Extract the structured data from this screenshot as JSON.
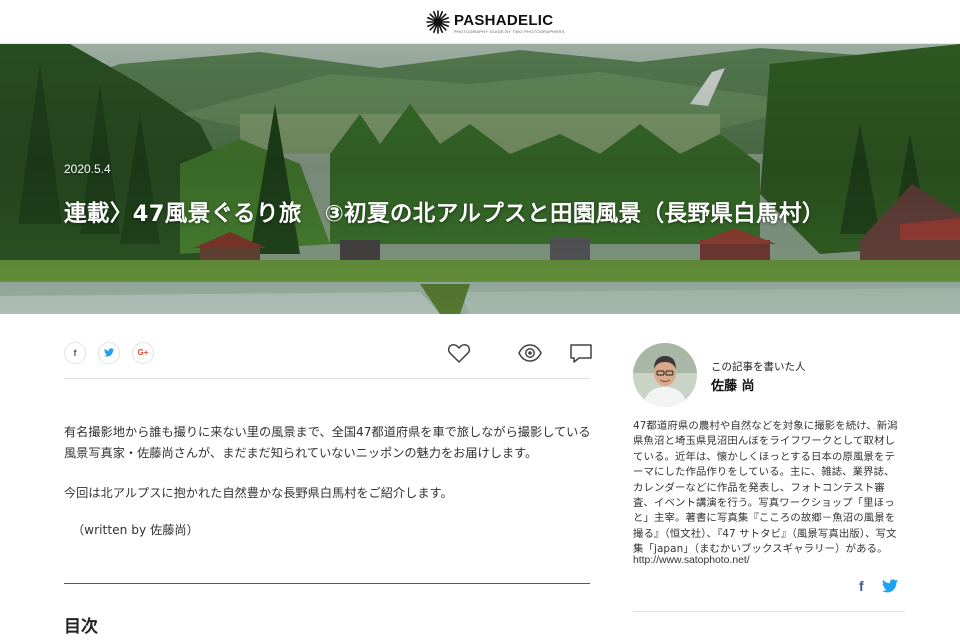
{
  "site": {
    "logo_text": "PASHADELIC",
    "logo_tagline": "PHOTOGRAPHY GUIDE BY TWO PHOTOGRAPHERS"
  },
  "article": {
    "date": "2020.5.4",
    "title": "連載〉47風景ぐるり旅　③初夏の北アルプスと田園風景（長野県白馬村）",
    "intro": "有名撮影地から誰も撮りに来ない里の風景まで、全国47都道府県を車で旅しながら撮影している風景写真家・佐藤尚さんが、まだまだ知られていないニッポンの魅力をお届けします。",
    "paragraph2": "今回は北アルプスに抱かれた自然豊かな長野県白馬村をご紹介します。",
    "byline": "（written by 佐藤尚）",
    "toc_title": "目次"
  },
  "share": {
    "facebook": "f",
    "twitter": "t",
    "googleplus": "G+"
  },
  "author": {
    "caption": "この記事を書いた人",
    "name": "佐藤 尚",
    "bio": "47都道府県の農村や自然などを対象に撮影を続け、新潟県魚沼と埼玉県見沼田んぼをライフワークとして取材している。近年は、懐かしくほっとする日本の原風景をテーマにした作品作りをしている。主に、雑誌、業界誌、カレンダーなどに作品を発表し、フォトコンテスト審査、イベント講演を行う。写真ワークショップ「里ほっと」主宰。著書に写真集『こころの故郷－魚沼の風景を撮る』（恒文社）、『47 サトタビ』（風景写真出版）、写文集「japan」（まむかいブックスギャラリー）がある。",
    "url": "http://www.satophoto.net/",
    "facebook": "f"
  },
  "colors": {
    "facebook": "#3b5998",
    "twitter": "#1da1f2",
    "googleplus": "#dd4b39",
    "divider": "#e0e0e0"
  },
  "icons": [
    "logo-starburst-icon",
    "facebook-icon",
    "twitter-icon",
    "google-plus-icon",
    "heart-icon",
    "eye-icon",
    "comment-icon"
  ]
}
